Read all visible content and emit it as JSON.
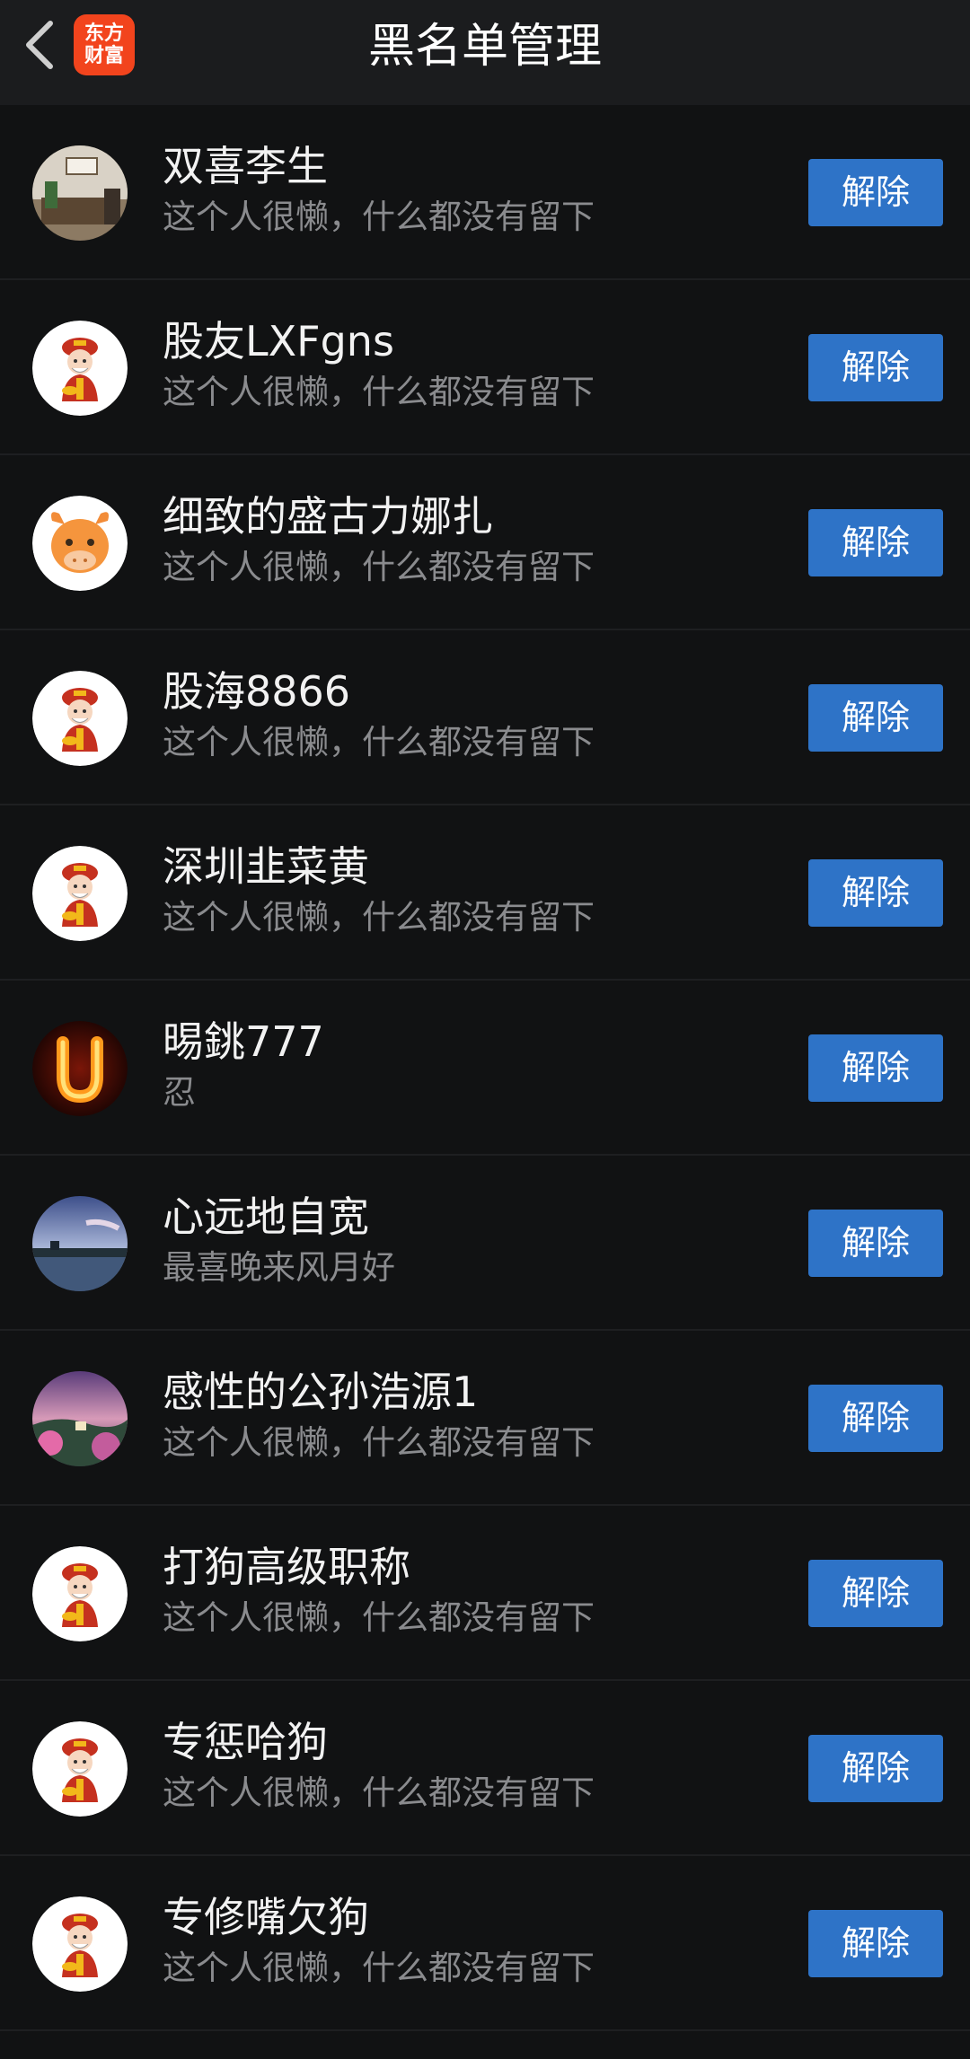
{
  "header": {
    "title": "黑名单管理",
    "logo_line1": "东方",
    "logo_line2": "财富",
    "brand_color": "#f2441d"
  },
  "accent_color": "#2e73c7",
  "blacklist": [
    {
      "name": "双喜李生",
      "signature": "这个人很懒，什么都没有留下",
      "avatar": "photo-room",
      "action": "解除"
    },
    {
      "name": "股友LXFgns",
      "signature": "这个人很懒，什么都没有留下",
      "avatar": "god-of-wealth",
      "action": "解除"
    },
    {
      "name": "细致的盛古力娜扎",
      "signature": "这个人很懒，什么都没有留下",
      "avatar": "ox-cartoon",
      "action": "解除"
    },
    {
      "name": "股海8866",
      "signature": "这个人很懒，什么都没有留下",
      "avatar": "god-of-wealth",
      "action": "解除"
    },
    {
      "name": "深圳韭菜黄",
      "signature": "这个人很懒，什么都没有留下",
      "avatar": "god-of-wealth",
      "action": "解除"
    },
    {
      "name": "晹銚777",
      "signature": "忍",
      "avatar": "fire-letter-u",
      "action": "解除"
    },
    {
      "name": "心远地自宽",
      "signature": "最喜晚来风月好",
      "avatar": "landscape-lake",
      "action": "解除"
    },
    {
      "name": "感性的公孙浩源1",
      "signature": "这个人很懒，什么都没有留下",
      "avatar": "landscape-flowers",
      "action": "解除"
    },
    {
      "name": "打狗高级职称",
      "signature": "这个人很懒，什么都没有留下",
      "avatar": "god-of-wealth",
      "action": "解除"
    },
    {
      "name": "专惩哈狗",
      "signature": "这个人很懒，什么都没有留下",
      "avatar": "god-of-wealth",
      "action": "解除"
    },
    {
      "name": "专修嘴欠狗",
      "signature": "这个人很懒，什么都没有留下",
      "avatar": "god-of-wealth",
      "action": "解除"
    }
  ]
}
